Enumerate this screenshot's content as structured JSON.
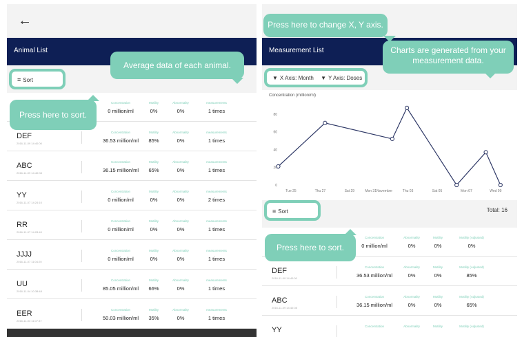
{
  "left": {
    "back_icon": "arrow-left-icon",
    "title": "Animal List",
    "sort_label": "Sort",
    "sort_icon": "filter-icon",
    "columns": [
      "Concentration",
      "Motility",
      "Abnormality",
      "measurements"
    ],
    "rows": [
      {
        "name": "",
        "date": "",
        "values": [
          "0 million/ml",
          "0%",
          "0%",
          "1 times"
        ]
      },
      {
        "name": "DEF",
        "date": "2016-11-09 14:40:00",
        "values": [
          "36.53 million/ml",
          "85%",
          "0%",
          "1 times"
        ]
      },
      {
        "name": "ABC",
        "date": "2016-11-09 14:40:08",
        "values": [
          "36.15 million/ml",
          "65%",
          "0%",
          "1 times"
        ]
      },
      {
        "name": "YY",
        "date": "2016-11-07 14:24:10",
        "values": [
          "0 million/ml",
          "0%",
          "0%",
          "2 times"
        ]
      },
      {
        "name": "RR",
        "date": "2016-11-07 14:03:40",
        "values": [
          "0 million/ml",
          "0%",
          "0%",
          "1 times"
        ]
      },
      {
        "name": "JJJJ",
        "date": "2016-11-07 11:04:20",
        "values": [
          "0 million/ml",
          "0%",
          "0%",
          "1 times"
        ]
      },
      {
        "name": "UU",
        "date": "2016-11-04 10:38:48",
        "values": [
          "85.05 million/ml",
          "66%",
          "0%",
          "1 times"
        ]
      },
      {
        "name": "EER",
        "date": "2016-11-03 11:07:37",
        "values": [
          "50.03 million/ml",
          "35%",
          "0%",
          "1 times"
        ]
      }
    ],
    "bubble_average": "Average data of each animal.",
    "bubble_sort": "Press here to sort."
  },
  "right": {
    "title": "Measurement List",
    "x_axis_label": "X Axis: Month",
    "y_axis_label": "Y Axis: Doses",
    "dropdown_icon": "triangle-down-icon",
    "sort_label": "Sort",
    "total": "Total: 16",
    "columns": [
      "Concentration",
      "Abnormality",
      "Motility",
      "Motility (Adjusted)"
    ],
    "rows": [
      {
        "name": "",
        "date": "",
        "values": [
          "0 million/ml",
          "0%",
          "0%",
          "0%"
        ]
      },
      {
        "name": "DEF",
        "date": "2016-11-09 14:40:00",
        "values": [
          "36.53 million/ml",
          "0%",
          "0%",
          "85%"
        ]
      },
      {
        "name": "ABC",
        "date": "2016-11-09 14:40:08",
        "values": [
          "36.15 million/ml",
          "0%",
          "0%",
          "65%"
        ]
      },
      {
        "name": "YY",
        "date": "",
        "values": [
          "",
          "",
          "",
          ""
        ]
      }
    ],
    "bubble_axis": "Press here to change X, Y axis.",
    "bubble_charts": "Charts are generated from your measurement data.",
    "bubble_sort": "Press here to sort."
  },
  "chart_data": {
    "type": "line",
    "ylabel": "Concentration (million/ml)",
    "ylim": [
      0,
      90
    ],
    "y_ticks": [
      0,
      20,
      40,
      60,
      80
    ],
    "x_ticks": [
      "Tue 25",
      "Thu 27",
      "Sat 29",
      "Mon 31November",
      "Thu 03",
      "Sat 05",
      "Mon 07",
      "Wed 09"
    ],
    "x_range": [
      0,
      7.5
    ],
    "series": [
      {
        "x": [
          -0.2,
          1.4,
          3.7,
          4.2,
          5.9,
          6.9,
          7.4
        ],
        "values": [
          21,
          70,
          52,
          87,
          0,
          37,
          0
        ]
      }
    ],
    "line_color": "#2e3866"
  },
  "colors": {
    "accent": "#7fcfb8",
    "navbar": "#0e1f55"
  }
}
